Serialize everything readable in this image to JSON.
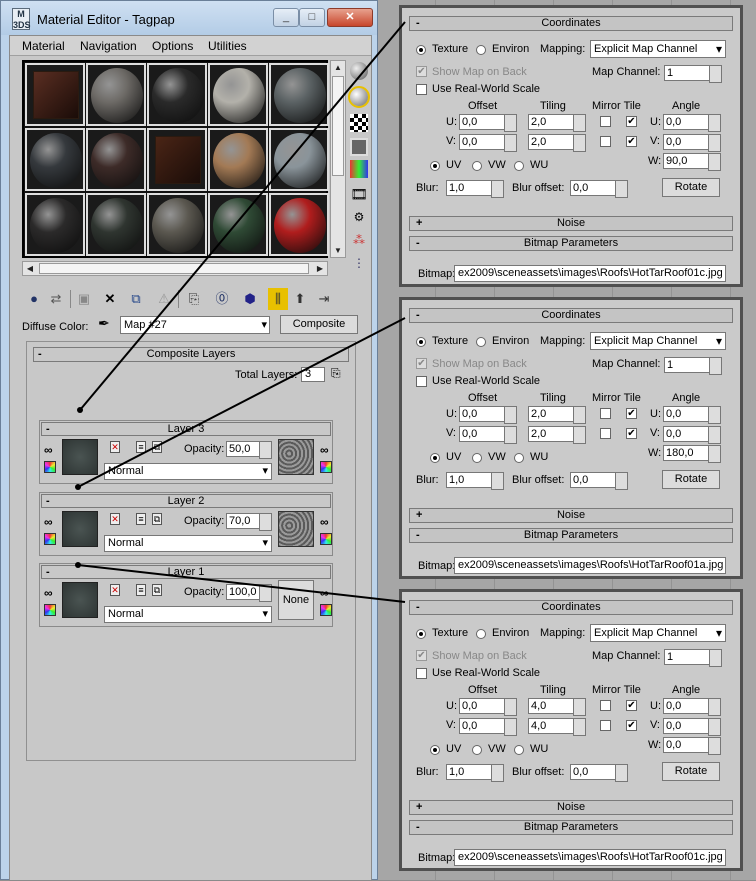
{
  "window": {
    "title": "Material Editor - Tagpap",
    "icon": "3ds-max-icon",
    "controls": [
      "_",
      "□",
      "✕"
    ]
  },
  "menu": [
    "Material",
    "Navigation",
    "Options",
    "Utilities"
  ],
  "slot_colors": [
    [
      "cube:#5a2e22",
      "#6d6a66",
      "#2a2a2a",
      "#b3b1aa",
      "#5b6264"
    ],
    [
      "#35393d",
      "#3d2b28",
      "cube:#4a2516",
      "#a37a55",
      "#8a949a"
    ],
    [
      "#2b2a2a",
      "#2f3530",
      "#5b5850",
      "#2f4a35",
      "#b01d1d"
    ]
  ],
  "diffuse": {
    "label": "Diffuse Color:",
    "map": "Map #27",
    "type_button": "Composite"
  },
  "composite": {
    "title": "Composite Layers",
    "total_label": "Total Layers:",
    "total": "3",
    "layers": [
      {
        "name": "Layer 3",
        "opacity_label": "Opacity:",
        "opacity": "50,0",
        "blend": "Normal",
        "mask": "noise-mask"
      },
      {
        "name": "Layer 2",
        "opacity_label": "Opacity:",
        "opacity": "70,0",
        "blend": "Normal",
        "mask": "noise-mask"
      },
      {
        "name": "Layer 1",
        "opacity_label": "Opacity:",
        "opacity": "100,0",
        "blend": "Normal",
        "mask_none": "None"
      }
    ]
  },
  "panel_labels": {
    "coordinates": "Coordinates",
    "texture": "Texture",
    "environ": "Environ",
    "mapping": "Mapping:",
    "show_map": "Show Map on Back",
    "map_channel": "Map Channel:",
    "real_world": "Use Real-World Scale",
    "offset": "Offset",
    "tiling": "Tiling",
    "mirror_tile": "Mirror Tile",
    "angle": "Angle",
    "u": "U:",
    "v": "V:",
    "w": "W:",
    "uv": "UV",
    "vw": "VW",
    "wu": "WU",
    "blur": "Blur:",
    "blur_offset": "Blur offset:",
    "rotate": "Rotate",
    "noise": "Noise",
    "bitmap_params": "Bitmap Parameters",
    "bitmap": "Bitmap:"
  },
  "panels": [
    {
      "mapping": "Explicit Map Channel",
      "channel": "1",
      "u_offset": "0,0",
      "v_offset": "0,0",
      "u_tiling": "2,0",
      "v_tiling": "2,0",
      "u_angle": "0,0",
      "v_angle": "0,0",
      "w_angle": "90,0",
      "blur": "1,0",
      "blur_offset": "0,0",
      "bitmap": "ex2009\\sceneassets\\images\\Roofs\\HotTarRoof01c.jpg"
    },
    {
      "mapping": "Explicit Map Channel",
      "channel": "1",
      "u_offset": "0,0",
      "v_offset": "0,0",
      "u_tiling": "2,0",
      "v_tiling": "2,0",
      "u_angle": "0,0",
      "v_angle": "0,0",
      "w_angle": "180,0",
      "blur": "1,0",
      "blur_offset": "0,0",
      "bitmap": "ex2009\\sceneassets\\images\\Roofs\\HotTarRoof01a.jpg"
    },
    {
      "mapping": "Explicit Map Channel",
      "channel": "1",
      "u_offset": "0,0",
      "v_offset": "0,0",
      "u_tiling": "4,0",
      "v_tiling": "4,0",
      "u_angle": "0,0",
      "v_angle": "0,0",
      "w_angle": "0,0",
      "blur": "1,0",
      "blur_offset": "0,0",
      "bitmap": "ex2009\\sceneassets\\images\\Roofs\\HotTarRoof01c.jpg"
    }
  ]
}
